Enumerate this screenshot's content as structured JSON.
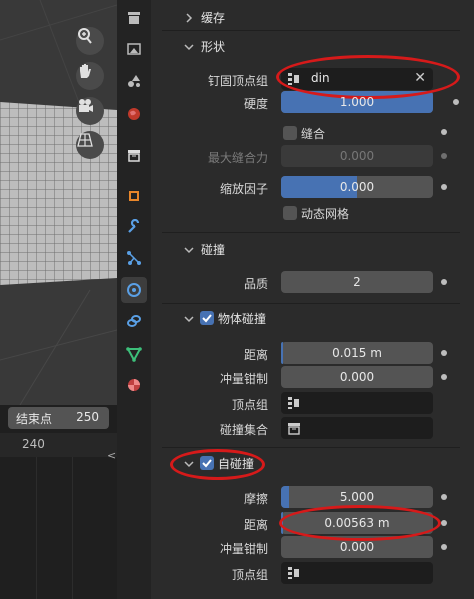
{
  "viewport": {
    "icons": [
      "zoom-icon",
      "hand-icon",
      "camera-icon",
      "grid-perspective-icon"
    ]
  },
  "timeline": {
    "end_label": "结束点",
    "end_value": "250",
    "ruler_mark": "240"
  },
  "tabs": [
    "tool-icon",
    "render-icon",
    "output-icon",
    "world-icon",
    "collection-icon",
    "object-icon",
    "modifier-icon",
    "particles-icon",
    "physics-icon",
    "constraints-icon",
    "data-icon",
    "material-icon"
  ],
  "sections": {
    "cache": "缓存",
    "shape": "形状",
    "collision": "碰撞",
    "object_collision": "物体碰撞",
    "self_collision": "自碰撞"
  },
  "shape": {
    "pin_group_label": "钉固顶点组",
    "pin_group_value": "din",
    "stiffness_label": "硬度",
    "stiffness_value": "1.000",
    "sewing_label": "缝合",
    "max_sewing_label": "最大缝合力",
    "max_sewing_value": "0.000",
    "shrink_label": "缩放因子",
    "shrink_value": "0.000",
    "dynamic_mesh_label": "动态网格"
  },
  "collision": {
    "quality_label": "品质",
    "quality_value": "2",
    "distance_label": "距离",
    "distance_value": "0.015 m",
    "impulse_label": "冲量钳制",
    "impulse_value": "0.000",
    "vgroup_label": "顶点组",
    "collection_label": "碰撞集合"
  },
  "self_collision": {
    "friction_label": "摩擦",
    "friction_value": "5.000",
    "distance_label": "距离",
    "distance_value": "0.00563 m",
    "impulse_label": "冲量钳制",
    "impulse_value": "0.000",
    "vgroup_label": "顶点组"
  },
  "colors": {
    "accent": "#4772b3",
    "highlight": "#d61a1a"
  }
}
